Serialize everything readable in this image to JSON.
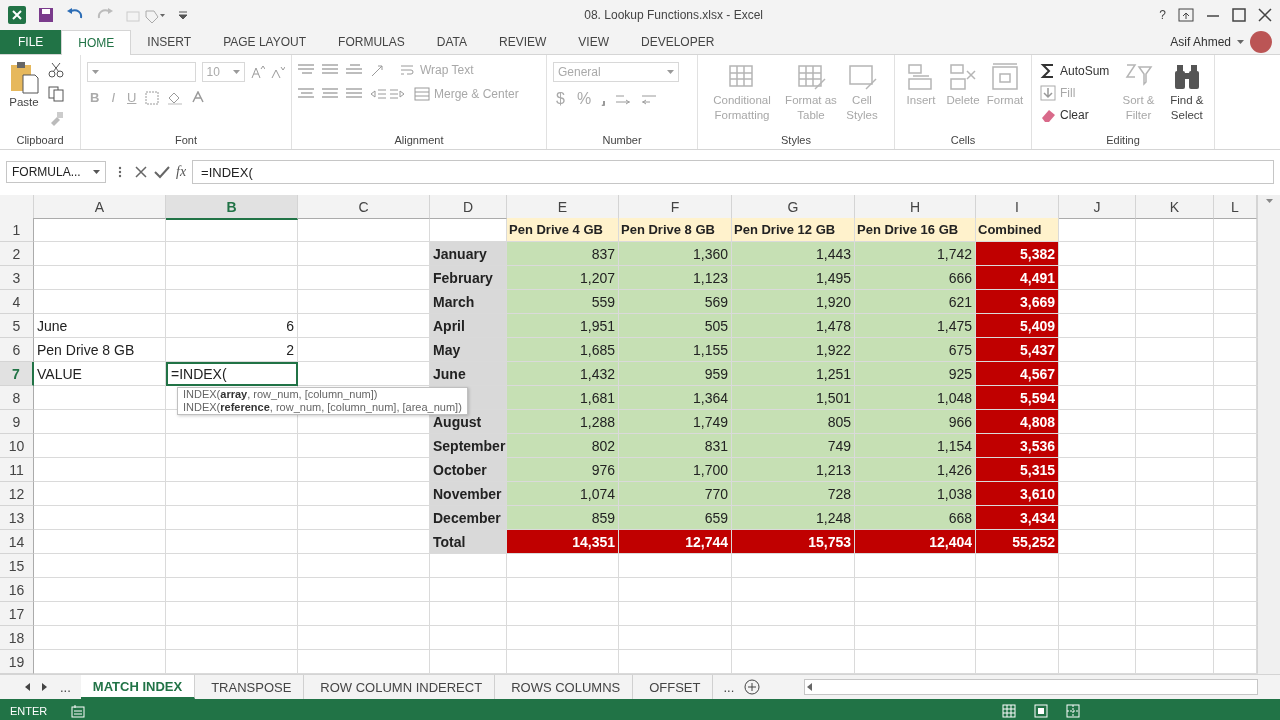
{
  "window": {
    "title": "08. Lookup Functions.xlsx - Excel",
    "help": "?",
    "user": "Asif Ahmed"
  },
  "ribbon_tabs": [
    {
      "label": "FILE",
      "kind": "file",
      "selected": false
    },
    {
      "label": "HOME",
      "kind": "tab",
      "selected": true
    },
    {
      "label": "INSERT",
      "kind": "tab",
      "selected": false
    },
    {
      "label": "PAGE LAYOUT",
      "kind": "tab",
      "selected": false
    },
    {
      "label": "FORMULAS",
      "kind": "tab",
      "selected": false
    },
    {
      "label": "DATA",
      "kind": "tab",
      "selected": false
    },
    {
      "label": "REVIEW",
      "kind": "tab",
      "selected": false
    },
    {
      "label": "VIEW",
      "kind": "tab",
      "selected": false
    },
    {
      "label": "DEVELOPER",
      "kind": "tab",
      "selected": false
    }
  ],
  "clipboard": {
    "title": "Clipboard",
    "paste": {
      "label": "Paste",
      "disabled": false
    }
  },
  "font": {
    "title": "Font",
    "size": "10",
    "styles": [
      "B",
      "I",
      "U"
    ]
  },
  "alignment": {
    "title": "Alignment",
    "wrap": {
      "label": "Wrap Text",
      "disabled": true
    },
    "merge": {
      "label": "Merge & Center",
      "disabled": true
    }
  },
  "number": {
    "title": "Number",
    "format": "General",
    "symbols": [
      "$",
      "%"
    ]
  },
  "styles": {
    "title": "Styles",
    "commands": [
      {
        "label": "Conditional Formatting",
        "disabled": true
      },
      {
        "label": "Format as Table",
        "disabled": true
      },
      {
        "label": "Cell Styles",
        "disabled": true
      }
    ]
  },
  "cells_group": {
    "title": "Cells",
    "commands": [
      {
        "label": "Insert",
        "disabled": true
      },
      {
        "label": "Delete",
        "disabled": true
      },
      {
        "label": "Format",
        "disabled": true
      }
    ]
  },
  "editing": {
    "title": "Editing",
    "small": [
      {
        "label": "AutoSum",
        "disabled": false
      },
      {
        "label": "Fill",
        "disabled": true
      },
      {
        "label": "Clear",
        "disabled": false
      }
    ],
    "large": [
      {
        "label": "Sort & Filter",
        "disabled": true
      },
      {
        "label": "Find & Select",
        "disabled": false
      }
    ]
  },
  "formula_bar": {
    "name_box": "FORMULA...",
    "function_label": "fx",
    "formula": "=INDEX("
  },
  "sheet": {
    "columns": [
      {
        "label": "A",
        "selected": false
      },
      {
        "label": "B",
        "selected": true
      },
      {
        "label": "C",
        "selected": false
      },
      {
        "label": "D",
        "selected": false
      },
      {
        "label": "E",
        "selected": false
      },
      {
        "label": "F",
        "selected": false
      },
      {
        "label": "G",
        "selected": false
      },
      {
        "label": "H",
        "selected": false
      },
      {
        "label": "I",
        "selected": false
      },
      {
        "label": "J",
        "selected": false
      },
      {
        "label": "K",
        "selected": false
      },
      {
        "label": "L",
        "selected": false
      }
    ],
    "rows": [
      {
        "label": "1",
        "selected": false,
        "cells": [
          null,
          null,
          null,
          null,
          {
            "text": "Pen Drive 4 GB",
            "kind": "header"
          },
          {
            "text": "Pen Drive 8 GB",
            "kind": "header"
          },
          {
            "text": "Pen Drive 12 GB",
            "kind": "header"
          },
          {
            "text": "Pen Drive 16 GB",
            "kind": "header"
          },
          {
            "text": "Combined",
            "kind": "header"
          }
        ]
      },
      {
        "label": "2",
        "selected": false,
        "cells": [
          null,
          null,
          null,
          {
            "text": "January",
            "kind": "month"
          },
          {
            "text": "837",
            "kind": "value"
          },
          {
            "text": "1,360",
            "kind": "value"
          },
          {
            "text": "1,443",
            "kind": "value"
          },
          {
            "text": "1,742",
            "kind": "value"
          },
          {
            "text": "5,382",
            "kind": "combined"
          }
        ]
      },
      {
        "label": "3",
        "selected": false,
        "cells": [
          null,
          null,
          null,
          {
            "text": "February",
            "kind": "month"
          },
          {
            "text": "1,207",
            "kind": "value"
          },
          {
            "text": "1,123",
            "kind": "value"
          },
          {
            "text": "1,495",
            "kind": "value"
          },
          {
            "text": "666",
            "kind": "value"
          },
          {
            "text": "4,491",
            "kind": "combined"
          }
        ]
      },
      {
        "label": "4",
        "selected": false,
        "cells": [
          null,
          null,
          null,
          {
            "text": "March",
            "kind": "month"
          },
          {
            "text": "559",
            "kind": "value"
          },
          {
            "text": "569",
            "kind": "value"
          },
          {
            "text": "1,920",
            "kind": "value"
          },
          {
            "text": "621",
            "kind": "value"
          },
          {
            "text": "3,669",
            "kind": "combined"
          }
        ]
      },
      {
        "label": "5",
        "selected": false,
        "cells": [
          {
            "text": "June",
            "kind": "text"
          },
          {
            "text": "6",
            "kind": "number"
          },
          null,
          {
            "text": "April",
            "kind": "month"
          },
          {
            "text": "1,951",
            "kind": "value"
          },
          {
            "text": "505",
            "kind": "value"
          },
          {
            "text": "1,478",
            "kind": "value"
          },
          {
            "text": "1,475",
            "kind": "value"
          },
          {
            "text": "5,409",
            "kind": "combined"
          }
        ]
      },
      {
        "label": "6",
        "selected": false,
        "cells": [
          {
            "text": "Pen Drive 8 GB",
            "kind": "text"
          },
          {
            "text": "2",
            "kind": "number"
          },
          null,
          {
            "text": "May",
            "kind": "month"
          },
          {
            "text": "1,685",
            "kind": "value"
          },
          {
            "text": "1,155",
            "kind": "value"
          },
          {
            "text": "1,922",
            "kind": "value"
          },
          {
            "text": "675",
            "kind": "value"
          },
          {
            "text": "5,437",
            "kind": "combined"
          }
        ]
      },
      {
        "label": "7",
        "selected": true,
        "cells": [
          {
            "text": "VALUE",
            "kind": "text"
          },
          {
            "text": "=INDEX(",
            "kind": "editing"
          },
          null,
          {
            "text": "June",
            "kind": "month"
          },
          {
            "text": "1,432",
            "kind": "value"
          },
          {
            "text": "959",
            "kind": "value"
          },
          {
            "text": "1,251",
            "kind": "value"
          },
          {
            "text": "925",
            "kind": "value"
          },
          {
            "text": "4,567",
            "kind": "combined"
          }
        ]
      },
      {
        "label": "8",
        "selected": false,
        "cells": [
          null,
          null,
          null,
          {
            "kind": "month"
          },
          {
            "text": "1,681",
            "kind": "value"
          },
          {
            "text": "1,364",
            "kind": "value"
          },
          {
            "text": "1,501",
            "kind": "value"
          },
          {
            "text": "1,048",
            "kind": "value"
          },
          {
            "text": "5,594",
            "kind": "combined"
          }
        ]
      },
      {
        "label": "9",
        "selected": false,
        "cells": [
          null,
          null,
          null,
          {
            "text": "August",
            "kind": "month"
          },
          {
            "text": "1,288",
            "kind": "value"
          },
          {
            "text": "1,749",
            "kind": "value"
          },
          {
            "text": "805",
            "kind": "value"
          },
          {
            "text": "966",
            "kind": "value"
          },
          {
            "text": "4,808",
            "kind": "combined"
          }
        ]
      },
      {
        "label": "10",
        "selected": false,
        "cells": [
          null,
          null,
          null,
          {
            "text": "September",
            "kind": "month"
          },
          {
            "text": "802",
            "kind": "value"
          },
          {
            "text": "831",
            "kind": "value"
          },
          {
            "text": "749",
            "kind": "value"
          },
          {
            "text": "1,154",
            "kind": "value"
          },
          {
            "text": "3,536",
            "kind": "combined"
          }
        ]
      },
      {
        "label": "11",
        "selected": false,
        "cells": [
          null,
          null,
          null,
          {
            "text": "October",
            "kind": "month"
          },
          {
            "text": "976",
            "kind": "value"
          },
          {
            "text": "1,700",
            "kind": "value"
          },
          {
            "text": "1,213",
            "kind": "value"
          },
          {
            "text": "1,426",
            "kind": "value"
          },
          {
            "text": "5,315",
            "kind": "combined"
          }
        ]
      },
      {
        "label": "12",
        "selected": false,
        "cells": [
          null,
          null,
          null,
          {
            "text": "November",
            "kind": "month"
          },
          {
            "text": "1,074",
            "kind": "value"
          },
          {
            "text": "770",
            "kind": "value"
          },
          {
            "text": "728",
            "kind": "value"
          },
          {
            "text": "1,038",
            "kind": "value"
          },
          {
            "text": "3,610",
            "kind": "combined"
          }
        ]
      },
      {
        "label": "13",
        "selected": false,
        "cells": [
          null,
          null,
          null,
          {
            "text": "December",
            "kind": "month"
          },
          {
            "text": "859",
            "kind": "value"
          },
          {
            "text": "659",
            "kind": "value"
          },
          {
            "text": "1,248",
            "kind": "value"
          },
          {
            "text": "668",
            "kind": "value"
          },
          {
            "text": "3,434",
            "kind": "combined"
          }
        ]
      },
      {
        "label": "14",
        "selected": false,
        "cells": [
          null,
          null,
          null,
          {
            "text": "Total",
            "kind": "month"
          },
          {
            "text": "14,351",
            "kind": "total"
          },
          {
            "text": "12,744",
            "kind": "total"
          },
          {
            "text": "15,753",
            "kind": "total"
          },
          {
            "text": "12,404",
            "kind": "total"
          },
          {
            "text": "55,252",
            "kind": "total"
          }
        ]
      },
      {
        "label": "15",
        "selected": false
      },
      {
        "label": "16",
        "selected": false
      },
      {
        "label": "17",
        "selected": false
      },
      {
        "label": "18",
        "selected": false
      },
      {
        "label": "19",
        "selected": false
      }
    ]
  },
  "tooltip": {
    "lines": [
      "INDEX(**array**, row_num, [column_num])",
      "INDEX(**reference**, row_num, [column_num], [area_num])"
    ]
  },
  "sheet_tabs": {
    "more_left": "...",
    "more_right": "...",
    "tabs": [
      {
        "label": "MATCH INDEX",
        "selected": true
      },
      {
        "label": "TRANSPOSE",
        "selected": false
      },
      {
        "label": "ROW COLUMN INDERECT",
        "selected": false
      },
      {
        "label": "ROWS COLUMNS",
        "selected": false
      },
      {
        "label": "OFFSET",
        "selected": false
      }
    ]
  },
  "status_bar": {
    "mode": "ENTER"
  }
}
